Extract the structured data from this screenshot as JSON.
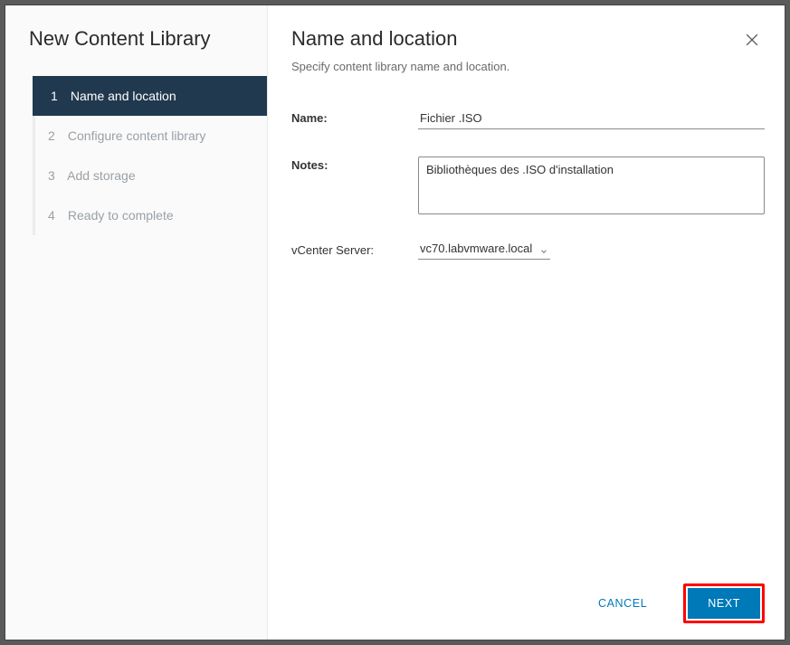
{
  "sidebar": {
    "title": "New Content Library",
    "steps": [
      {
        "num": "1",
        "label": "Name and location",
        "active": true
      },
      {
        "num": "2",
        "label": "Configure content library",
        "active": false
      },
      {
        "num": "3",
        "label": "Add storage",
        "active": false
      },
      {
        "num": "4",
        "label": "Ready to complete",
        "active": false
      }
    ]
  },
  "main": {
    "title": "Name and location",
    "subtitle": "Specify content library name and location.",
    "fields": {
      "name_label": "Name:",
      "name_value": "Fichier .ISO",
      "notes_label": "Notes:",
      "notes_value": "Bibliothèques des .ISO d'installation",
      "vcenter_label": "vCenter Server:",
      "vcenter_value": "vc70.labvmware.local"
    }
  },
  "footer": {
    "cancel": "CANCEL",
    "next": "NEXT"
  }
}
